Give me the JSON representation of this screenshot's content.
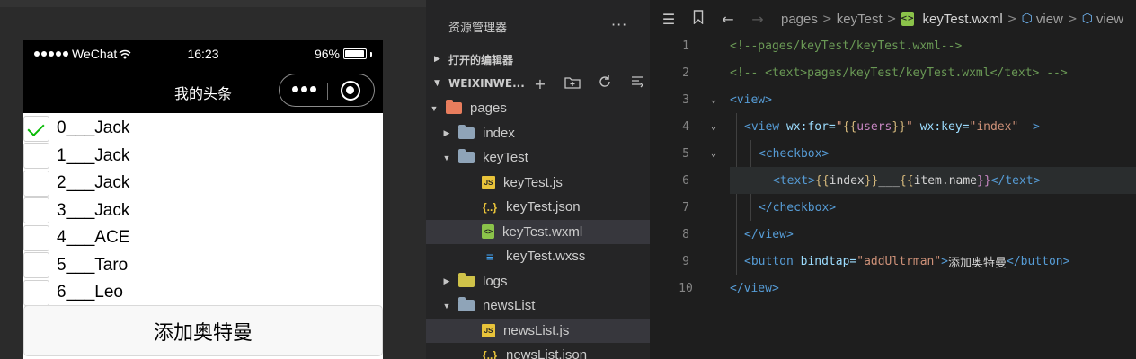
{
  "simulator": {
    "status_bar": {
      "carrier": "WeChat",
      "time": "16:23",
      "battery": "96%",
      "battery_level": 0.96
    },
    "nav_title": "我的头条",
    "list": [
      {
        "label": "0___Jack",
        "checked": true
      },
      {
        "label": "1___Jack",
        "checked": false
      },
      {
        "label": "2___Jack",
        "checked": false
      },
      {
        "label": "3___Jack",
        "checked": false
      },
      {
        "label": "4___ACE",
        "checked": false
      },
      {
        "label": "5___Taro",
        "checked": false
      },
      {
        "label": "6___Leo",
        "checked": false
      }
    ],
    "add_button": "添加奥特曼"
  },
  "explorer": {
    "title": "资源管理器",
    "more": "···",
    "open_editors": "打开的编辑器",
    "project": "WEIXINWE...",
    "tree": [
      {
        "label": "pages",
        "type": "folder-pages",
        "expanded": true
      },
      {
        "label": "index",
        "type": "folder",
        "expanded": false
      },
      {
        "label": "keyTest",
        "type": "folder",
        "expanded": true
      },
      {
        "label": "keyTest.js",
        "type": "js"
      },
      {
        "label": "keyTest.json",
        "type": "json"
      },
      {
        "label": "keyTest.wxml",
        "type": "wxml",
        "selected": true
      },
      {
        "label": "keyTest.wxss",
        "type": "wxss"
      },
      {
        "label": "logs",
        "type": "folder-logs",
        "expanded": false
      },
      {
        "label": "newsList",
        "type": "folder",
        "expanded": true
      },
      {
        "label": "newsList.js",
        "type": "js",
        "selected": true
      },
      {
        "label": "newsList.json",
        "type": "json"
      }
    ]
  },
  "editor": {
    "breadcrumb": [
      "pages",
      "keyTest",
      "keyTest.wxml",
      "view",
      "view"
    ],
    "line_numbers": [
      "1",
      "2",
      "3",
      "4",
      "5",
      "6",
      "7",
      "8",
      "9",
      "10"
    ],
    "code": {
      "l1": "<!--pages/keyTest/keyTest.wxml-->",
      "l2": "<!-- <text>pages/keyTest/keyTest.wxml</text> -->",
      "l3_tag": "<view>",
      "l4_open": "<view",
      "l4_attr1": " wx:for=",
      "l4_q1": "\"",
      "l4_b1": "{{",
      "l4_v1": "users",
      "l4_b2": "}}",
      "l4_q2": "\"",
      "l4_attr2": " wx:key=",
      "l4_v2": "\"index\"",
      "l4_close": "  >",
      "l5": "<checkbox>",
      "l6_open": "<text>",
      "l6_b1": "{{",
      "l6_v1": "index",
      "l6_b2": "}}",
      "l6_us": "___",
      "l6_b3": "{{",
      "l6_v2": "item.name",
      "l6_b4": "}}",
      "l6_close": "</text>",
      "l7": "</checkbox>",
      "l8": "</view>",
      "l9_open": "<button",
      "l9_attr": " bindtap=",
      "l9_val": "\"addUltrman\"",
      "l9_gt": ">",
      "l9_text": "添加奥特曼",
      "l9_close": "</button>",
      "l10": "</view>"
    }
  }
}
